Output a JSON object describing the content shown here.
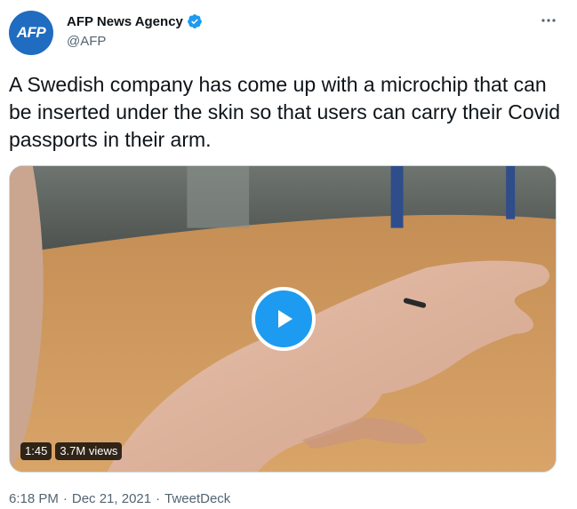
{
  "author": {
    "avatar_text": "AFP",
    "display_name": "AFP News Agency",
    "handle": "@AFP",
    "verified": true
  },
  "tweet": {
    "text": "A Swedish company has come up with a microchip that can be inserted under the skin so that users can carry their Covid passports in their arm."
  },
  "video": {
    "duration": "1:45",
    "views": "3.7M views"
  },
  "meta": {
    "time": "6:18 PM",
    "separator_1": "·",
    "date": "Dec 21, 2021",
    "separator_2": "·",
    "source": "TweetDeck"
  },
  "colors": {
    "accent": "#1d9bf0",
    "avatar_bg": "#1f6cc0",
    "secondary_text": "#536471"
  },
  "icons": {
    "verified": "verified-badge-icon",
    "more": "more-dots-icon",
    "play": "play-icon"
  }
}
